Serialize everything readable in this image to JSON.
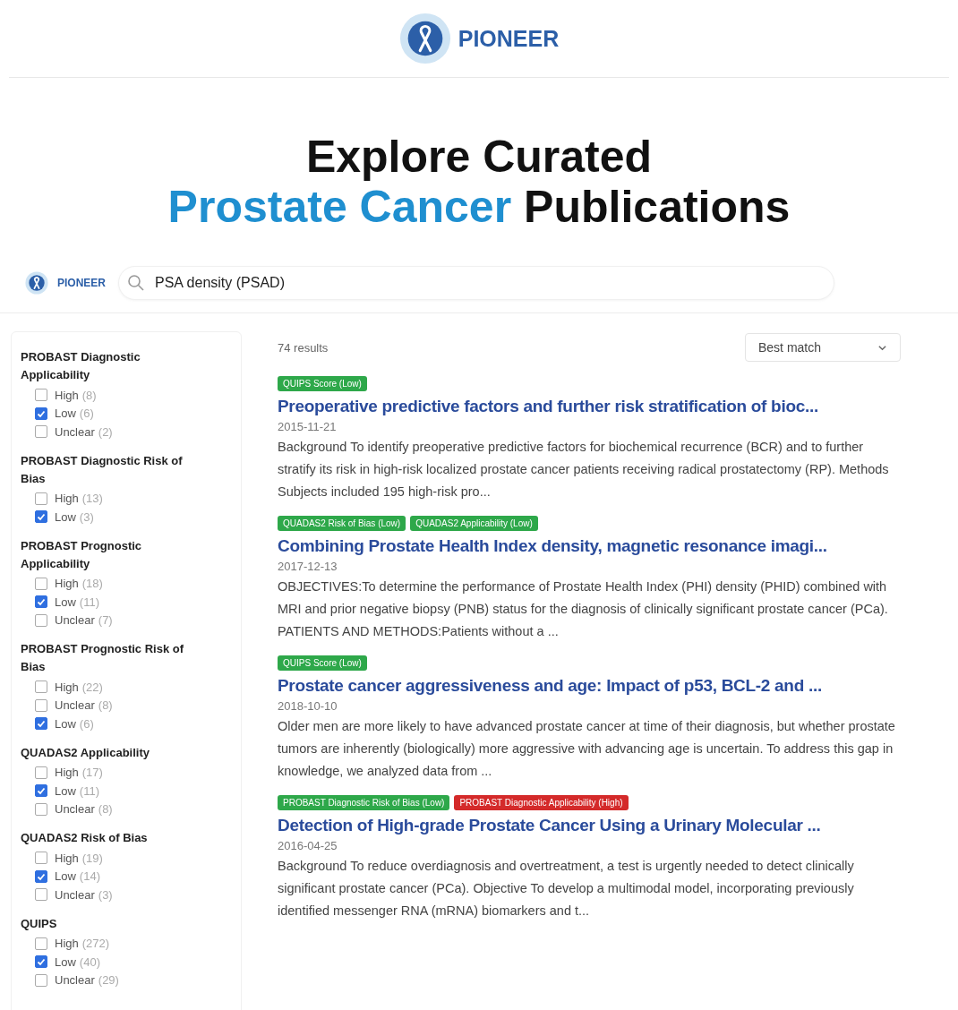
{
  "header": {
    "brand": "PIONEER"
  },
  "headline": {
    "line_1": "Explore Curated",
    "highlight": "Prostate Cancer",
    "rest": "Publications"
  },
  "search_bar": {
    "brand": "PIONEER",
    "value": "PSA density (PSAD)"
  },
  "filters": [
    {
      "title": "PROBAST Diagnostic Applicability",
      "options": [
        {
          "label": "High",
          "count": "(8)",
          "checked": false
        },
        {
          "label": "Low",
          "count": "(6)",
          "checked": true
        },
        {
          "label": "Unclear",
          "count": "(2)",
          "checked": false
        }
      ]
    },
    {
      "title": "PROBAST Diagnostic Risk of Bias",
      "options": [
        {
          "label": "High",
          "count": "(13)",
          "checked": false
        },
        {
          "label": "Low",
          "count": "(3)",
          "checked": true
        }
      ]
    },
    {
      "title": "PROBAST Prognostic Applicability",
      "options": [
        {
          "label": "High",
          "count": "(18)",
          "checked": false
        },
        {
          "label": "Low",
          "count": "(11)",
          "checked": true
        },
        {
          "label": "Unclear",
          "count": "(7)",
          "checked": false
        }
      ]
    },
    {
      "title": "PROBAST Prognostic Risk of Bias",
      "options": [
        {
          "label": "High",
          "count": "(22)",
          "checked": false
        },
        {
          "label": "Unclear",
          "count": "(8)",
          "checked": false
        },
        {
          "label": "Low",
          "count": "(6)",
          "checked": true
        }
      ]
    },
    {
      "title": "QUADAS2 Applicability",
      "options": [
        {
          "label": "High",
          "count": "(17)",
          "checked": false
        },
        {
          "label": "Low",
          "count": "(11)",
          "checked": true
        },
        {
          "label": "Unclear",
          "count": "(8)",
          "checked": false
        }
      ]
    },
    {
      "title": "QUADAS2 Risk of Bias",
      "options": [
        {
          "label": "High",
          "count": "(19)",
          "checked": false
        },
        {
          "label": "Low",
          "count": "(14)",
          "checked": true
        },
        {
          "label": "Unclear",
          "count": "(3)",
          "checked": false
        }
      ]
    },
    {
      "title": "QUIPS",
      "options": [
        {
          "label": "High",
          "count": "(272)",
          "checked": false
        },
        {
          "label": "Low",
          "count": "(40)",
          "checked": true
        },
        {
          "label": "Unclear",
          "count": "(29)",
          "checked": false
        }
      ]
    }
  ],
  "results_count": "74 results",
  "sort": {
    "value": "Best match"
  },
  "results": [
    {
      "tags": [
        {
          "label": "QUIPS Score (Low)",
          "color": "#2ea84a"
        }
      ],
      "title": "Preoperative predictive factors and further risk stratification of bioc...",
      "date": "2015-11-21",
      "abstract": "Background To identify preoperative predictive factors for biochemical recurrence (BCR) and to further stratify its risk in high-risk localized prostate cancer patients receiving radical prostatectomy (RP). Methods Subjects included 195 high-risk pro..."
    },
    {
      "tags": [
        {
          "label": "QUADAS2 Risk of Bias (Low)",
          "color": "#2ea84a"
        },
        {
          "label": "QUADAS2 Applicability (Low)",
          "color": "#2ea84a"
        }
      ],
      "title": "Combining Prostate Health Index density, magnetic resonance imagi...",
      "date": "2017-12-13",
      "abstract": "OBJECTIVES:To determine the performance of Prostate Health Index (PHI) density (PHID) combined with MRI and prior negative biopsy (PNB) status for the diagnosis of clinically significant prostate cancer (PCa). PATIENTS AND METHODS:Patients without a ..."
    },
    {
      "tags": [
        {
          "label": "QUIPS Score (Low)",
          "color": "#2ea84a"
        }
      ],
      "title": "Prostate cancer aggressiveness and age: Impact of p53, BCL-2 and ...",
      "date": "2018-10-10",
      "abstract": "Older men are more likely to have advanced prostate cancer at time of their diagnosis, but whether prostate tumors are inherently (biologically) more aggressive with advancing age is uncertain. To address this gap in knowledge, we analyzed data from ..."
    },
    {
      "tags": [
        {
          "label": "PROBAST Diagnostic Risk of Bias (Low)",
          "color": "#2ea84a"
        },
        {
          "label": "PROBAST Diagnostic Applicability (High)",
          "color": "#d42a2a"
        }
      ],
      "title": "Detection of High-grade Prostate Cancer Using a Urinary Molecular ...",
      "date": "2016-04-25",
      "abstract": "Background To reduce overdiagnosis and overtreatment, a test is urgently needed to detect clinically significant prostate cancer (PCa). Objective To develop a multimodal model, incorporating previously identified messenger RNA (mRNA) biomarkers and t..."
    }
  ]
}
